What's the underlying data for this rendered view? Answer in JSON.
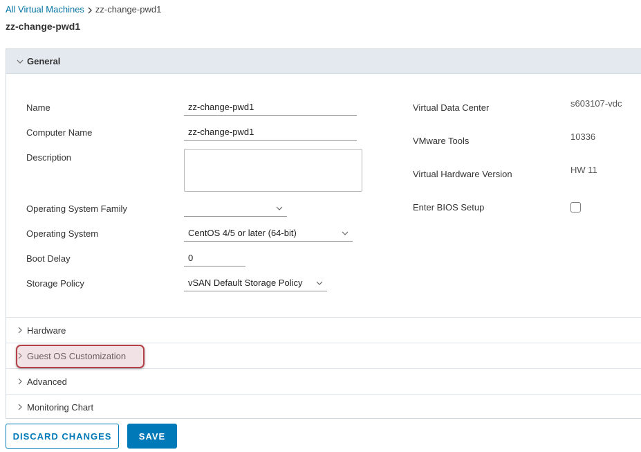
{
  "breadcrumb": {
    "parent": "All Virtual Machines",
    "current": "zz-change-pwd1"
  },
  "page": {
    "title": "zz-change-pwd1"
  },
  "general": {
    "header": "General",
    "fields": {
      "name_label": "Name",
      "name_value": "zz-change-pwd1",
      "computer_name_label": "Computer Name",
      "computer_name_value": "zz-change-pwd1",
      "description_label": "Description",
      "description_value": "",
      "os_family_label": "Operating System Family",
      "os_family_value": "",
      "os_label": "Operating System",
      "os_value": "CentOS 4/5 or later (64-bit)",
      "boot_delay_label": "Boot Delay",
      "boot_delay_value": "0",
      "storage_policy_label": "Storage Policy",
      "storage_policy_value": "vSAN Default Storage Policy"
    },
    "info": {
      "vdc_label": "Virtual Data Center",
      "vdc_value": "s603107-vdc",
      "vmware_tools_label": "VMware Tools",
      "vmware_tools_value": "10336",
      "hw_version_label": "Virtual Hardware Version",
      "hw_version_value": "HW 11",
      "bios_label": "Enter BIOS Setup",
      "bios_checked": false
    }
  },
  "sections": {
    "hardware": "Hardware",
    "guest_os": "Guest OS Customization",
    "advanced": "Advanced",
    "monitoring": "Monitoring Chart"
  },
  "buttons": {
    "discard": "DISCARD CHANGES",
    "save": "SAVE"
  },
  "colors": {
    "accent": "#0079b8",
    "link": "#0072a3",
    "highlight_border": "#b5404a",
    "general_header_bg": "#e3e9ee"
  },
  "icons": {
    "breadcrumb_separator": "chevron-right-icon",
    "section_expanded": "chevron-down-icon",
    "section_collapsed": "chevron-right-icon",
    "select_caret": "caret-down-icon"
  }
}
